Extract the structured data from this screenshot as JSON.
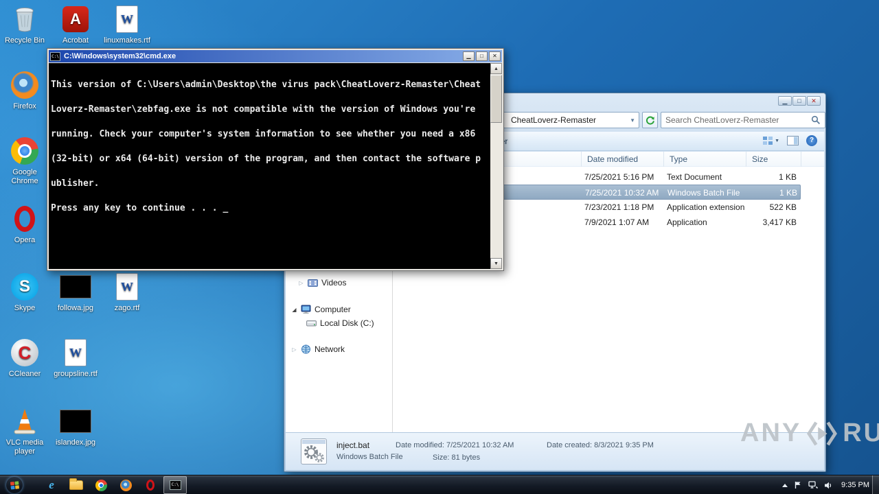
{
  "desktop": {
    "icons": [
      {
        "label": "Recycle Bin",
        "icon": "recycle-bin"
      },
      {
        "label": "Acrobat",
        "icon": "adobe-acrobat"
      },
      {
        "label": "linuxmakes.rtf",
        "icon": "rtf-document"
      },
      {
        "label": "Firefox",
        "icon": "firefox"
      },
      {
        "label": "Google Chrome",
        "icon": "google-chrome"
      },
      {
        "label": "Opera",
        "icon": "opera"
      },
      {
        "label": "Skype",
        "icon": "skype"
      },
      {
        "label": "followa.jpg",
        "icon": "image-thumbnail"
      },
      {
        "label": "zago.rtf",
        "icon": "rtf-document"
      },
      {
        "label": "CCleaner",
        "icon": "ccleaner"
      },
      {
        "label": "groupsline.rtf",
        "icon": "rtf-document"
      },
      {
        "label": "VLC media player",
        "icon": "vlc"
      },
      {
        "label": "islandex.jpg",
        "icon": "image-thumbnail"
      }
    ]
  },
  "cmd_window": {
    "title": "C:\\Windows\\system32\\cmd.exe",
    "window_buttons": [
      "minimize",
      "maximize",
      "close"
    ],
    "console_lines": [
      "This version of C:\\Users\\admin\\Desktop\\the virus pack\\CheatLoverz-Remaster\\Cheat",
      "Loverz-Remaster\\zebfag.exe is not compatible with the version of Windows you're",
      "running. Check your computer's system information to see whether you need a x86",
      "(32-bit) or x64 (64-bit) version of the program, and then contact the software p",
      "ublisher.",
      "Press any key to continue . . . _"
    ]
  },
  "explorer": {
    "window_buttons": [
      "minimize",
      "maximize",
      "close"
    ],
    "address": "CheatLoverz-Remaster",
    "search_placeholder": "Search CheatLoverz-Remaster",
    "toolbar": {
      "new_folder": "New folder",
      "icons": [
        "change-view",
        "preview-pane",
        "help"
      ]
    },
    "columns": [
      "Date modified",
      "Type",
      "Size"
    ],
    "files": [
      {
        "date_modified": "7/25/2021 5:16 PM",
        "type": "Text Document",
        "size": "1 KB",
        "selected": false
      },
      {
        "date_modified": "7/25/2021 10:32 AM",
        "type": "Windows Batch File",
        "size": "1 KB",
        "selected": true
      },
      {
        "date_modified": "7/23/2021 1:18 PM",
        "type": "Application extension",
        "size": "522 KB",
        "selected": false
      },
      {
        "date_modified": "7/9/2021 1:07 AM",
        "type": "Application",
        "size": "3,417 KB",
        "selected": false
      }
    ],
    "sidebar": [
      {
        "label": "Videos",
        "icon": "videos-library"
      },
      {
        "label": "Computer",
        "icon": "computer"
      },
      {
        "label": "Local Disk (C:)",
        "icon": "local-disk"
      },
      {
        "label": "Network",
        "icon": "network"
      }
    ],
    "details_pane": {
      "file_name": "inject.bat",
      "file_type": "Windows Batch File",
      "date_modified": "Date modified: 7/25/2021 10:32 AM",
      "size": "Size: 81 bytes",
      "date_created": "Date created: 8/3/2021 9:35 PM",
      "icon": "batch-file-gears"
    }
  },
  "taskbar": {
    "buttons": [
      "internet-explorer",
      "windows-explorer",
      "google-chrome",
      "firefox",
      "opera",
      "command-prompt"
    ],
    "active_button": "command-prompt",
    "tray_icons": [
      "show-hidden-icons",
      "action-center-flag",
      "network",
      "volume"
    ],
    "clock": "9:35 PM"
  },
  "watermark": {
    "text_left": "ANY",
    "text_right": "RUN",
    "icon": "anyrun-play-logo"
  }
}
